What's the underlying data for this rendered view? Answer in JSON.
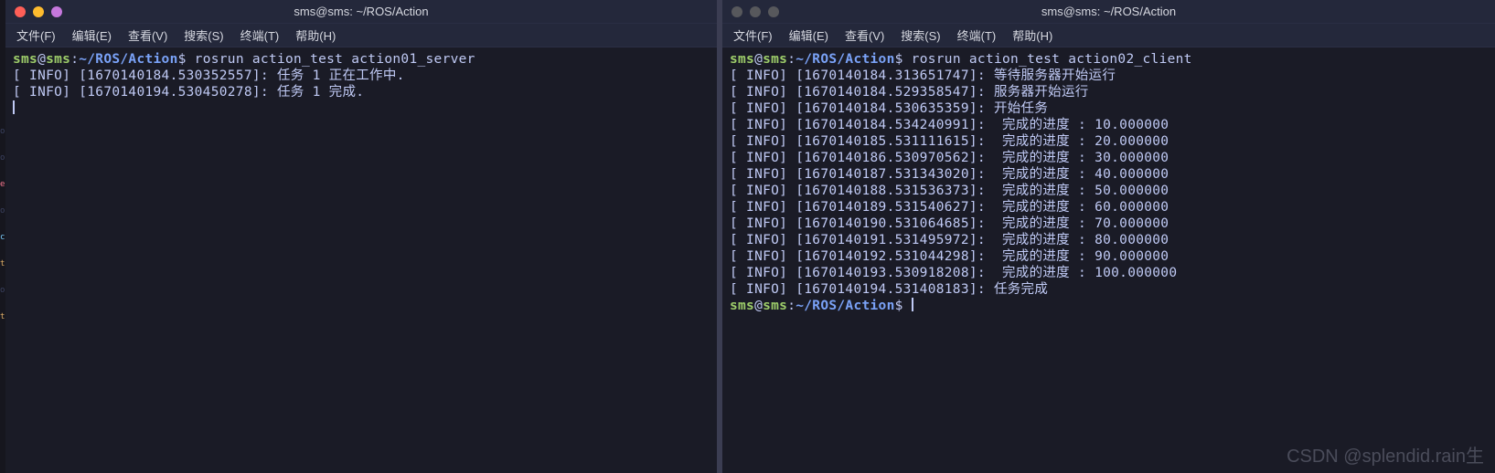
{
  "side_icons": [
    "o",
    "o",
    "e",
    "o",
    "c",
    "t",
    "o",
    "t"
  ],
  "left": {
    "titlebar_dots": [
      "red",
      "yellow",
      "pink"
    ],
    "title": "sms@sms: ~/ROS/Action",
    "menus": [
      "文件(F)",
      "编辑(E)",
      "查看(V)",
      "搜索(S)",
      "终端(T)",
      "帮助(H)"
    ],
    "prompt": {
      "user": "sms",
      "at": "@",
      "host": "sms",
      "colon": ":",
      "path": "~/ROS/Action",
      "sym": "$"
    },
    "command": "rosrun action_test action01_server",
    "logs": [
      "[ INFO] [1670140184.530352557]: 任务 1 正在工作中.",
      "[ INFO] [1670140194.530450278]: 任务 1 完成."
    ]
  },
  "right": {
    "titlebar_dots": [
      "grey",
      "grey",
      "grey"
    ],
    "title": "sms@sms: ~/ROS/Action",
    "menus": [
      "文件(F)",
      "编辑(E)",
      "查看(V)",
      "搜索(S)",
      "终端(T)",
      "帮助(H)"
    ],
    "prompt": {
      "user": "sms",
      "at": "@",
      "host": "sms",
      "colon": ":",
      "path": "~/ROS/Action",
      "sym": "$"
    },
    "command": "rosrun action_test action02_client",
    "logs": [
      "[ INFO] [1670140184.313651747]: 等待服务器开始运行",
      "[ INFO] [1670140184.529358547]: 服务器开始运行",
      "[ INFO] [1670140184.530635359]: 开始任务",
      "[ INFO] [1670140184.534240991]:  完成的进度 : 10.000000",
      "[ INFO] [1670140185.531111615]:  完成的进度 : 20.000000",
      "[ INFO] [1670140186.530970562]:  完成的进度 : 30.000000",
      "[ INFO] [1670140187.531343020]:  完成的进度 : 40.000000",
      "[ INFO] [1670140188.531536373]:  完成的进度 : 50.000000",
      "[ INFO] [1670140189.531540627]:  完成的进度 : 60.000000",
      "[ INFO] [1670140190.531064685]:  完成的进度 : 70.000000",
      "[ INFO] [1670140191.531495972]:  完成的进度 : 80.000000",
      "[ INFO] [1670140192.531044298]:  完成的进度 : 90.000000",
      "[ INFO] [1670140193.530918208]:  完成的进度 : 100.000000",
      "[ INFO] [1670140194.531408183]: 任务完成"
    ],
    "final_prompt": true
  },
  "watermark": "CSDN @splendid.rain生"
}
